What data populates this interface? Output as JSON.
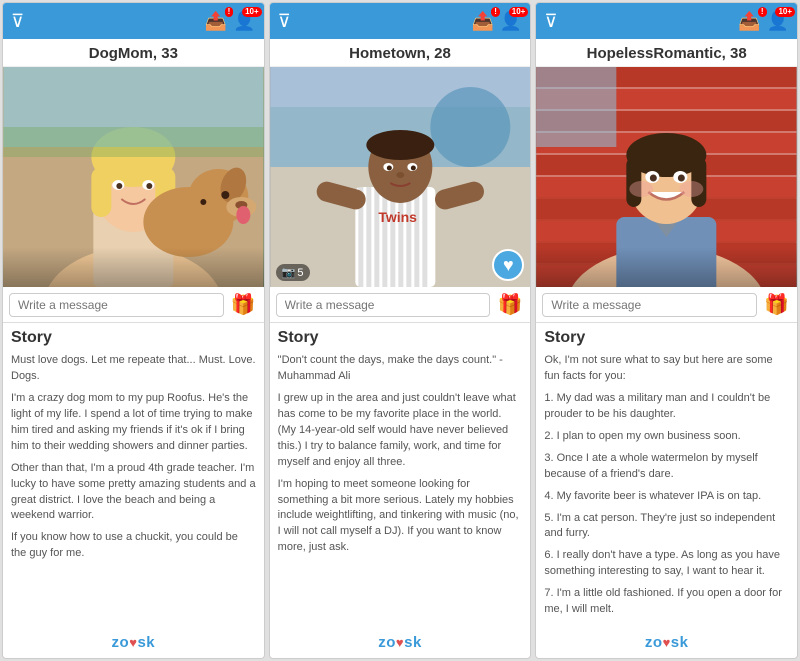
{
  "cards": [
    {
      "id": "card1",
      "name": "DogMom, 33",
      "header": {
        "filter_icon": "▼",
        "badge1": "!",
        "badge2": "10+",
        "icon1": "📤",
        "icon2": "👤"
      },
      "photo_bg": "#8ba5c8",
      "message_placeholder": "Write a message",
      "story_title": "Story",
      "story_paragraphs": [
        "Must love dogs. Let me repeate that... Must. Love. Dogs.",
        "I'm a crazy dog mom to my pup Roofus. He's the light of my life. I spend a lot of time trying to make him tired and asking my friends if it's ok if I bring him to their wedding showers and dinner parties.",
        "Other than that, I'm a proud 4th grade teacher. I'm lucky to have some pretty amazing students and a great district. I love the beach and being a weekend warrior.",
        "If you know how to use a chuckit, you could be the guy for me."
      ],
      "photo_emoji": "🐕",
      "has_heart": false,
      "has_count": false
    },
    {
      "id": "card2",
      "name": "Hometown, 28",
      "header": {
        "filter_icon": "▼",
        "badge1": "!",
        "badge2": "10+",
        "icon1": "📤",
        "icon2": "👤"
      },
      "photo_bg": "#7a9fc0",
      "message_placeholder": "Write a message",
      "story_title": "Story",
      "story_paragraphs": [
        "\"Don't count the days, make the days count.\" -Muhammad Ali",
        "I grew up in the area and just couldn't leave what has come to be my favorite place in the world. (My 14-year-old self would have never believed this.) I try to balance family, work, and time for myself and enjoy all three.",
        "I'm hoping to meet someone looking for something a bit more serious. Lately my hobbies include weightlifting, and tinkering with music (no, I will not call myself a DJ). If you want to know more, just ask."
      ],
      "photo_emoji": "⚾",
      "has_heart": true,
      "has_count": true,
      "count_label": "5"
    },
    {
      "id": "card3",
      "name": "HopelessRomantic, 38",
      "header": {
        "filter_icon": "▼",
        "badge1": "!",
        "badge2": "10+",
        "icon1": "📤",
        "icon2": "👤"
      },
      "photo_bg": "#c0503a",
      "message_placeholder": "Write a message",
      "story_title": "Story",
      "story_paragraphs": [
        "Ok, I'm not sure what to say but here are some fun facts for you:",
        "1. My dad was a military man and I couldn't be prouder to be his daughter.",
        "2. I plan to open my own business soon.",
        "3. Once I ate a whole watermelon by myself because of a friend's dare.",
        "4. My favorite beer is whatever IPA is on tap.",
        "5. I'm a cat person. They're just so independent and furry.",
        "6. I really don't have a type. As long as you have something interesting to say, I want to hear it.",
        "7. I'm a little old fashioned. If you open a door for me, I will melt."
      ],
      "photo_emoji": "😊",
      "has_heart": false,
      "has_count": false
    }
  ],
  "zoosk_label": "zo sk",
  "zoosk_heart": "♥"
}
